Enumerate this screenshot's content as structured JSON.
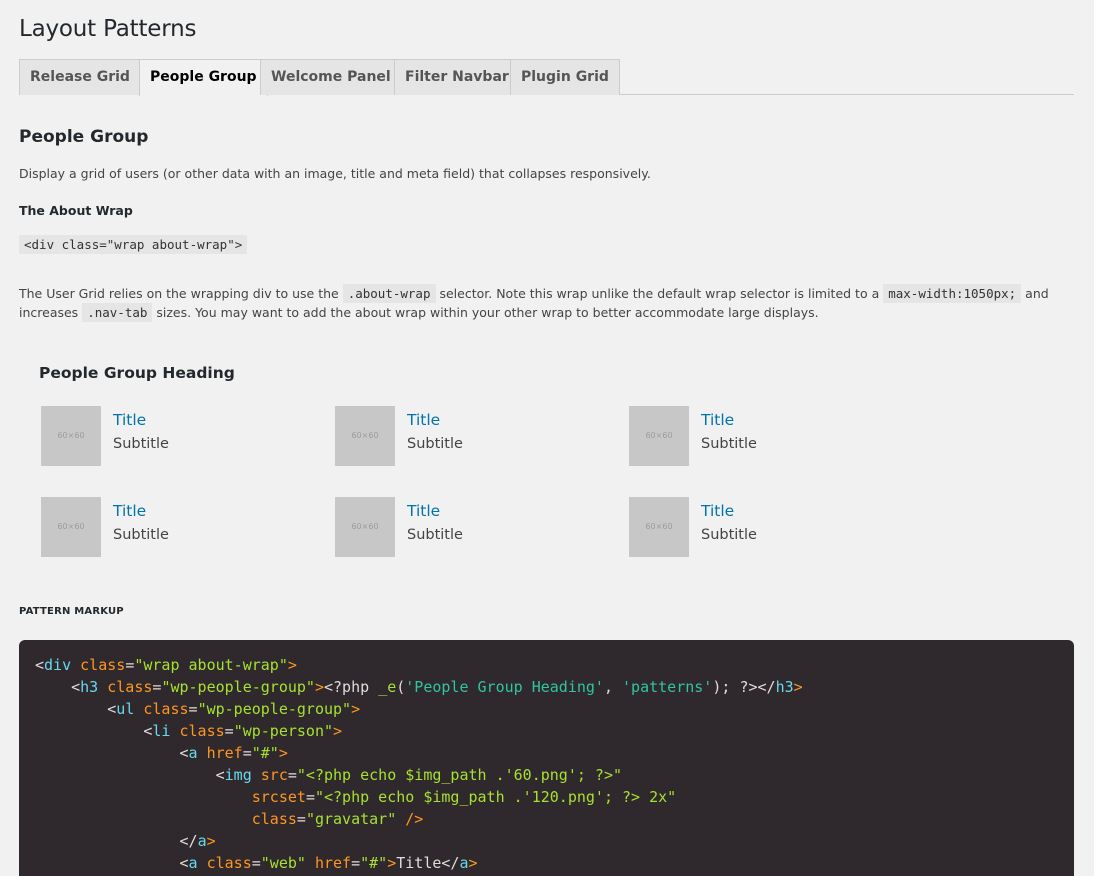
{
  "page": {
    "title": "Layout Patterns"
  },
  "tabs": [
    {
      "label": "Release Grid"
    },
    {
      "label": "People Group"
    },
    {
      "label": "Welcome Panel"
    },
    {
      "label": "Filter Navbar"
    },
    {
      "label": "Plugin Grid"
    }
  ],
  "active_tab": "People Group",
  "section": {
    "title": "People Group",
    "description": "Display a grid of users (or other data with an image, title and meta field) that collapses responsively.",
    "about_heading": "The About Wrap",
    "about_code": "<div class=\"wrap about-wrap\">",
    "para_1": "The User Grid relies on the wrapping div to use the",
    "para_code_1": ".about-wrap",
    "para_2": "selector. Note this wrap unlike the default wrap selector is limited to a",
    "para_code_2": "max-width:1050px;",
    "para_3": "and",
    "para_4": "increases",
    "para_code_3": ".nav-tab",
    "para_5": "sizes. You may want to add the about wrap within your other wrap to better accommodate large displays."
  },
  "people": {
    "heading": "People Group Heading",
    "items": [
      {
        "avatar": "60×60",
        "title": "Title",
        "subtitle": "Subtitle"
      },
      {
        "avatar": "60×60",
        "title": "Title",
        "subtitle": "Subtitle"
      },
      {
        "avatar": "60×60",
        "title": "Title",
        "subtitle": "Subtitle"
      },
      {
        "avatar": "60×60",
        "title": "Title",
        "subtitle": "Subtitle"
      },
      {
        "avatar": "60×60",
        "title": "Title",
        "subtitle": "Subtitle"
      },
      {
        "avatar": "60×60",
        "title": "Title",
        "subtitle": "Subtitle"
      }
    ]
  },
  "markup": {
    "label": "PATTERN MARKUP",
    "lines": [
      "<div class=\"wrap about-wrap\">",
      "    <h3 class=\"wp-people-group\"><?php _e('People Group Heading', 'patterns'); ?></h3>",
      "        <ul class=\"wp-people-group\">",
      "            <li class=\"wp-person\">",
      "                <a href=\"#\">",
      "                    <img src=\"<?php echo $img_path .'60.png'; ?>\"",
      "                        srcset=\"<?php echo $img_path .'120.png'; ?> 2x\"",
      "                        class=\"gravatar\" />",
      "                </a>",
      "                <a class=\"web\" href=\"#\">Title</a>"
    ]
  },
  "colors": {
    "background": "#f1f1f1",
    "link": "#0073aa",
    "code_bg": "#2f282d",
    "avatar_bg": "#c7c7c7"
  }
}
